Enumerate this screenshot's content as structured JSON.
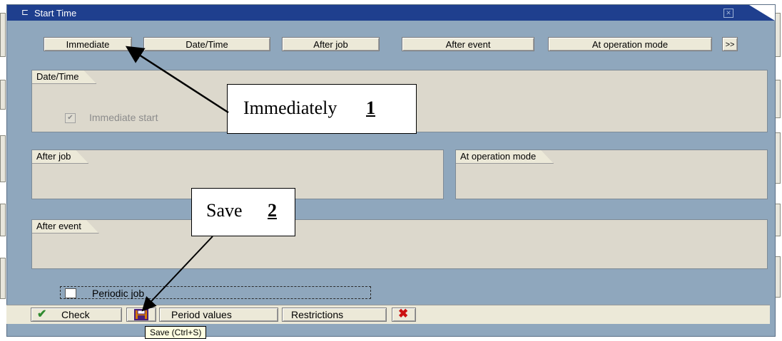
{
  "window": {
    "title": "Start Time"
  },
  "tabs": [
    {
      "label": "Immediate"
    },
    {
      "label": "Date/Time"
    },
    {
      "label": "After job"
    },
    {
      "label": "After event"
    },
    {
      "label": "At operation mode"
    },
    {
      "label": ">>"
    }
  ],
  "groups": {
    "datetime": {
      "label": "Date/Time",
      "checkbox_label": "Immediate start"
    },
    "after_job": {
      "label": "After job"
    },
    "operation_mode": {
      "label": "At operation mode"
    },
    "after_event": {
      "label": "After event"
    }
  },
  "periodic": {
    "label": "Periodic job"
  },
  "toolbar": {
    "check_label": "Check",
    "period_values_label": "Period values",
    "restrictions_label": "Restrictions"
  },
  "tooltip": "Save   (Ctrl+S)",
  "callouts": {
    "immediately": {
      "text": "Immediately",
      "num": "1"
    },
    "save": {
      "text": "Save",
      "num": "2"
    }
  },
  "colors": {
    "title_bar": "#1f3f8e",
    "window_bg": "#8fa7bd",
    "group_bg": "#dcd8cc",
    "check_icon": "#2f8a2f",
    "cancel_icon": "#cc1111",
    "save_icon": "#d97a00"
  },
  "icons": [
    "window-icon",
    "close-icon",
    "check-icon",
    "save-icon",
    "cancel-icon"
  ]
}
